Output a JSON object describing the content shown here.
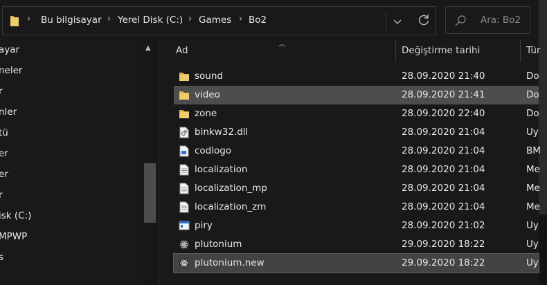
{
  "address": {
    "crumbs": [
      "Bu bilgisayar",
      "Yerel Disk (C:)",
      "Games",
      "Bo2"
    ]
  },
  "search": {
    "placeholder": "Ara: Bo2"
  },
  "nav": {
    "items": [
      "ayar",
      "neler",
      "r",
      "nler",
      "tü",
      "er",
      "er",
      "r",
      "isk (C:)",
      "MPWP",
      "s"
    ]
  },
  "columns": {
    "name": "Ad",
    "date": "Değiştirme tarihi",
    "type": "Tür"
  },
  "files": [
    {
      "name": "sound",
      "date": "28.09.2020 21:40",
      "type": "Do",
      "icon": "folder-icon"
    },
    {
      "name": "video",
      "date": "28.09.2020 21:41",
      "type": "Do",
      "icon": "folder-icon",
      "state": "selected"
    },
    {
      "name": "zone",
      "date": "28.09.2020 22:40",
      "type": "Do",
      "icon": "folder-icon"
    },
    {
      "name": "binkw32.dll",
      "date": "28.09.2020 21:04",
      "type": "Uy",
      "icon": "dll-file-icon"
    },
    {
      "name": "codlogo",
      "date": "28.09.2020 21:04",
      "type": "BM",
      "icon": "bitmap-file-icon"
    },
    {
      "name": "localization",
      "date": "28.09.2020 21:04",
      "type": "Me",
      "icon": "text-file-icon"
    },
    {
      "name": "localization_mp",
      "date": "28.09.2020 21:04",
      "type": "Me",
      "icon": "text-file-icon"
    },
    {
      "name": "localization_zm",
      "date": "28.09.2020 21:04",
      "type": "Me",
      "icon": "text-file-icon"
    },
    {
      "name": "piry",
      "date": "28.09.2020 21:02",
      "type": "Uy",
      "icon": "application-window-icon"
    },
    {
      "name": "plutonium",
      "date": "29.09.2020 18:22",
      "type": "Uy",
      "icon": "atom-app-icon"
    },
    {
      "name": "plutonium.new",
      "date": "29.09.2020 18:22",
      "type": "Uy",
      "icon": "atom-app-icon",
      "state": "focused"
    }
  ],
  "colors": {
    "background": "#191919",
    "selected_row": "#4d4d4d",
    "folder": "#e8c15f",
    "text": "#e8e8e8"
  }
}
